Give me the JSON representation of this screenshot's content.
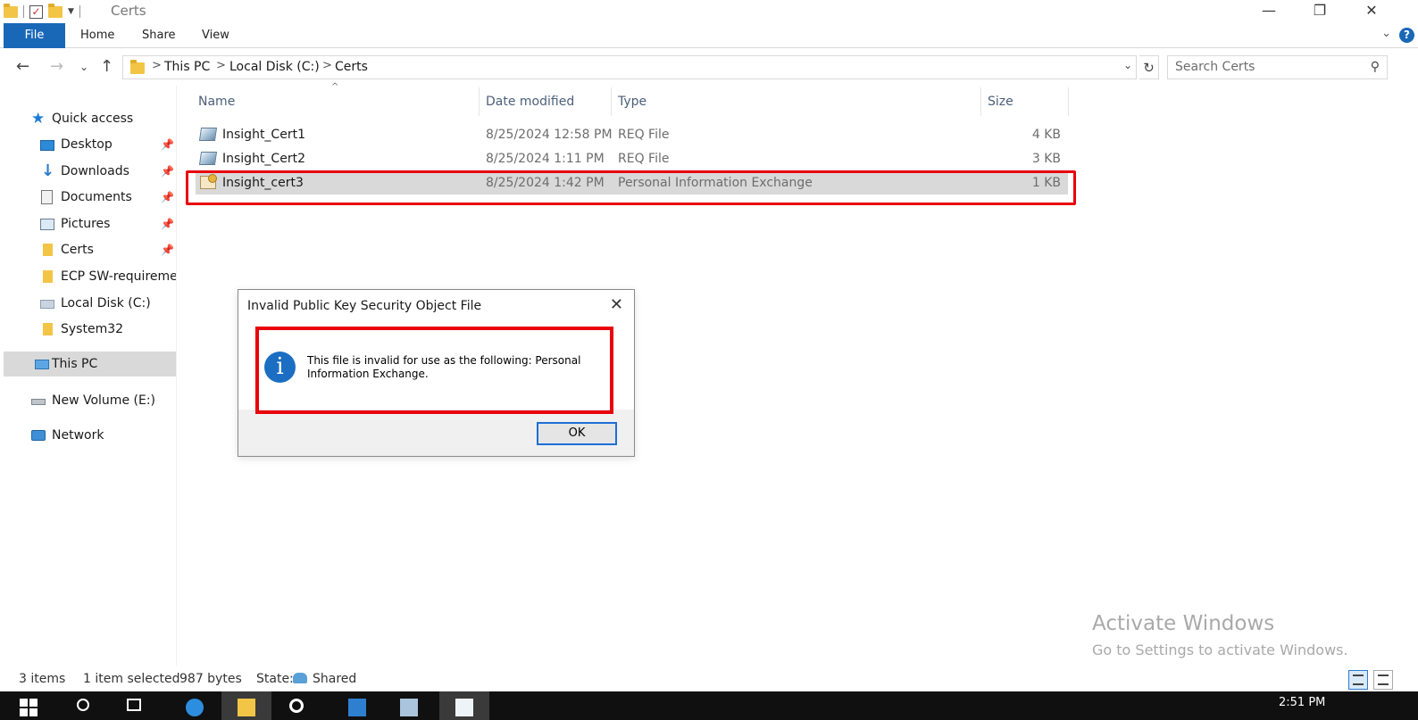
{
  "window": {
    "title": "Certs",
    "minimize_glyph": "—",
    "maximize_glyph": "❐",
    "close_glyph": "✕"
  },
  "ribbon": {
    "file": "File",
    "tabs": [
      "Home",
      "Share",
      "View"
    ],
    "help": "?"
  },
  "address": {
    "crumbs": [
      "This PC",
      "Local Disk (C:)",
      "Certs"
    ],
    "separator": ">"
  },
  "search": {
    "placeholder": "Search Certs"
  },
  "nav": {
    "items": [
      {
        "label": "Quick access",
        "icon": "star-icon",
        "pinned": false
      },
      {
        "label": "Desktop",
        "icon": "desktop-icon",
        "pinned": true
      },
      {
        "label": "Downloads",
        "icon": "download-icon",
        "pinned": true
      },
      {
        "label": "Documents",
        "icon": "documents-icon",
        "pinned": true
      },
      {
        "label": "Pictures",
        "icon": "pictures-icon",
        "pinned": true
      },
      {
        "label": "Certs",
        "icon": "folder-icon",
        "pinned": true
      },
      {
        "label": "ECP SW-requiremer",
        "icon": "folder-icon",
        "pinned": false
      },
      {
        "label": "Local Disk (C:)",
        "icon": "disk-icon",
        "pinned": false
      },
      {
        "label": "System32",
        "icon": "folder-icon",
        "pinned": false
      },
      {
        "label": "This PC",
        "icon": "computer-icon",
        "pinned": false,
        "selected": true
      },
      {
        "label": "New Volume (E:)",
        "icon": "drive-icon",
        "pinned": false
      },
      {
        "label": "Network",
        "icon": "network-icon",
        "pinned": false
      }
    ]
  },
  "columns": {
    "name": "Name",
    "date": "Date modified",
    "type": "Type",
    "size": "Size"
  },
  "files": [
    {
      "name": "Insight_Cert1",
      "date": "8/25/2024 12:58 PM",
      "type": "REQ File",
      "size": "4 KB",
      "icon": "req-file-icon"
    },
    {
      "name": "Insight_Cert2",
      "date": "8/25/2024 1:11 PM",
      "type": "REQ File",
      "size": "3 KB",
      "icon": "req-file-icon"
    },
    {
      "name": "Insight_cert3",
      "date": "8/25/2024 1:42 PM",
      "type": "Personal Information Exchange",
      "size": "1 KB",
      "icon": "pfx-file-icon",
      "selected": true
    }
  ],
  "dialog": {
    "title": "Invalid Public Key Security Object File",
    "message": "This file is invalid for use as the following: Personal Information Exchange.",
    "ok": "OK",
    "icon": "info-icon",
    "info_glyph": "i"
  },
  "watermark": {
    "line1": "Activate Windows",
    "line2": "Go to Settings to activate Windows."
  },
  "status": {
    "items": "3 items",
    "selected": "1 item selected",
    "size": "987 bytes",
    "state_label": "State:",
    "state_value": "Shared"
  },
  "taskbar": {
    "clock": "2:51 PM"
  },
  "colors": {
    "accent": "#1968b8",
    "highlight_red": "#e8000b",
    "selection": "#d9d9d9"
  }
}
